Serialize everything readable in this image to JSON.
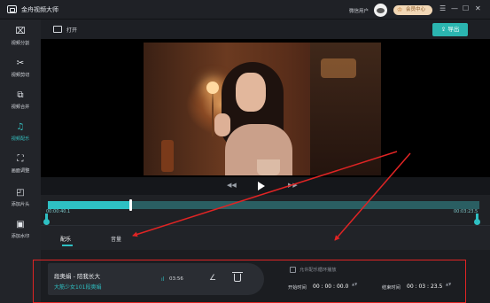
{
  "app": {
    "title": "金舟视频大师",
    "user_name": "微信用户",
    "vip_label": "会员中心",
    "vip_icon": "crown-icon",
    "window_controls": [
      "☰",
      "—",
      "☐",
      "✕"
    ]
  },
  "sidebar": {
    "items": [
      {
        "label": "视频分割",
        "icon": "split-icon",
        "glyph": "⌧",
        "active": false
      },
      {
        "label": "视频剪切",
        "icon": "scissors-icon",
        "glyph": "✂",
        "active": false
      },
      {
        "label": "视频合并",
        "icon": "merge-icon",
        "glyph": "⧉",
        "active": false
      },
      {
        "label": "视频配乐",
        "icon": "music-icon",
        "glyph": "♫",
        "active": true
      },
      {
        "label": "画面调整",
        "icon": "crop-icon",
        "glyph": "⛶",
        "active": false
      },
      {
        "label": "添加片头",
        "icon": "intro-icon",
        "glyph": "◰",
        "active": false
      },
      {
        "label": "添加水印",
        "icon": "watermark-icon",
        "glyph": "▣",
        "active": false
      }
    ]
  },
  "toolbar": {
    "open_label": "打开",
    "export_label": "导出",
    "export_icon": "export-icon"
  },
  "player": {
    "prev_icon": "rewind-icon",
    "play_icon": "play-icon",
    "next_icon": "forward-icon",
    "prev_glyph": "◀◀",
    "next_glyph": "▶▶",
    "progress": 0.19
  },
  "timeline": {
    "start_time": "00:00:40.1",
    "end_time": "00:03:23.5"
  },
  "tabs": [
    {
      "label": "配乐",
      "active": true
    },
    {
      "label": "音量",
      "active": false
    }
  ],
  "music": {
    "title": "段奥娟 - 陪我长大",
    "artist": "大筋少女101段奥娟",
    "duration_icon": "bars-icon",
    "duration_glyph": "ıl",
    "duration": "03:56",
    "edit_icon": "edit-icon",
    "edit_glyph": "∠",
    "delete_icon": "trash-icon",
    "loop_label": "允许配乐循环播放",
    "start_label": "开始时间",
    "start_time": "00 : 00 : 00.0",
    "end_label": "结束时间",
    "end_time": "00 : 03 : 23.5",
    "spin_glyph": "▲▼"
  },
  "colors": {
    "accent": "#2ec0c3",
    "annotation": "#e02424",
    "background": "#1b1d22"
  }
}
